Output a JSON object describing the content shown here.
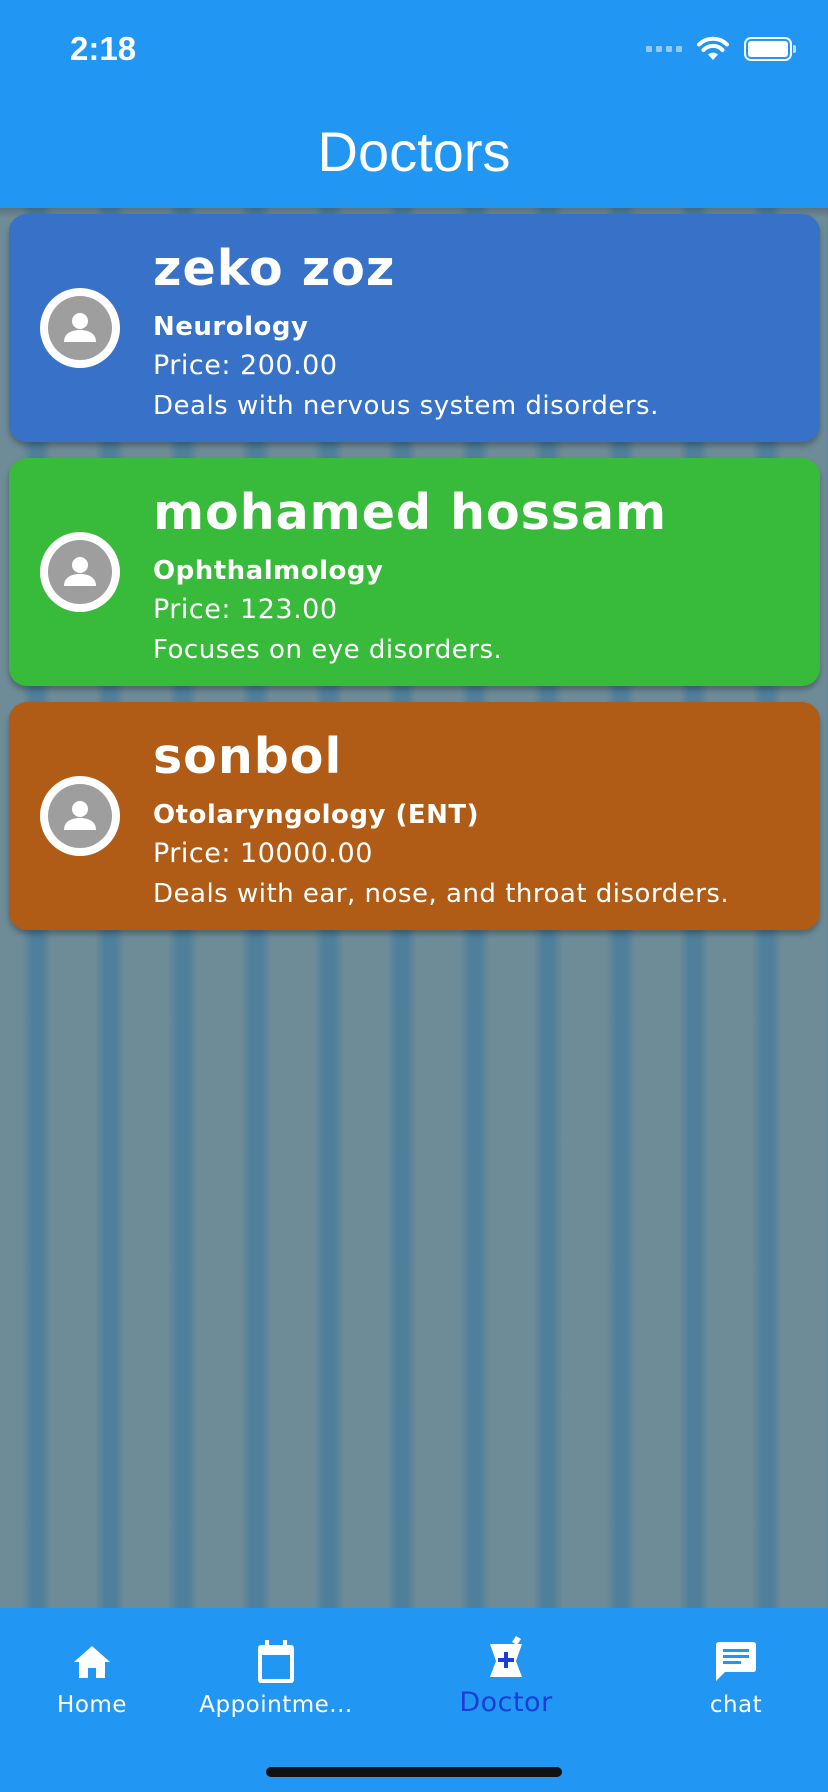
{
  "status_bar": {
    "time": "2:18"
  },
  "app_bar": {
    "title": "Doctors"
  },
  "doctors": [
    {
      "name": "zeko zoz",
      "specialty": "Neurology",
      "price": "Price: 200.00",
      "description": "Deals with nervous system disorders.",
      "color": "#3871c8"
    },
    {
      "name": "mohamed hossam",
      "specialty": "Ophthalmology",
      "price": "Price: 123.00",
      "description": "Focuses on eye disorders.",
      "color": "#38bb3a"
    },
    {
      "name": "sonbol",
      "specialty": "Otolaryngology (ENT)",
      "price": "Price: 10000.00",
      "description": "Deals with ear, nose, and throat disorders.",
      "color": "#b05c17"
    }
  ],
  "bottom_nav": {
    "items": [
      {
        "label": "Home",
        "icon": "home-icon"
      },
      {
        "label": "Appointme...",
        "icon": "calendar-icon"
      },
      {
        "label": "Doctor",
        "icon": "medical-kit-icon",
        "active": true
      },
      {
        "label": "chat",
        "icon": "chat-icon"
      }
    ]
  },
  "colors": {
    "primary": "#2196f3",
    "active_nav": "#1a3ed6"
  }
}
